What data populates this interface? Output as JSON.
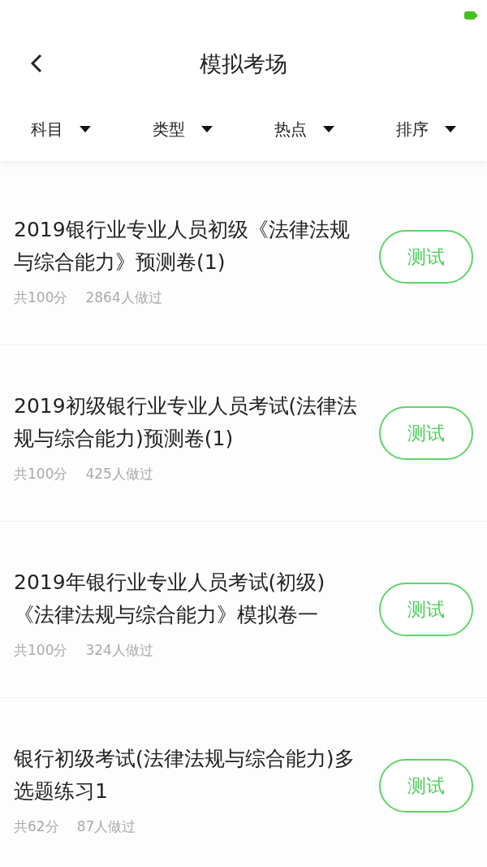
{
  "header": {
    "title": "模拟考场"
  },
  "filters": [
    {
      "label": "科目"
    },
    {
      "label": "类型"
    },
    {
      "label": "热点"
    },
    {
      "label": "排序"
    }
  ],
  "exams": [
    {
      "title": "2019银行业专业人员初级《法律法规与综合能力》预测卷(1)",
      "score": "共100分",
      "takers": "2864人做过",
      "button": "测试"
    },
    {
      "title": "2019初级银行业专业人员考试(法律法规与综合能力)预测卷(1)",
      "score": "共100分",
      "takers": "425人做过",
      "button": "测试"
    },
    {
      "title": "2019年银行业专业人员考试(初级)《法律法规与综合能力》模拟卷一",
      "score": "共100分",
      "takers": "324人做过",
      "button": "测试"
    },
    {
      "title": "银行初级考试(法律法规与综合能力)多选题练习1",
      "score": "共62分",
      "takers": "87人做过",
      "button": "测试"
    }
  ]
}
